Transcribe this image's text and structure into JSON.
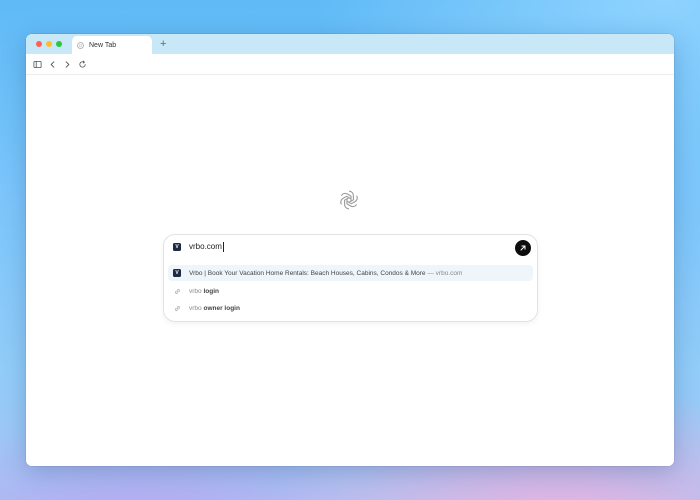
{
  "browser": {
    "tab": {
      "title": "New Tab"
    },
    "new_tab_label": "+"
  },
  "omnibox": {
    "value": "vrbo.com",
    "site_icon_letter": "V",
    "suggestions": [
      {
        "type": "site",
        "icon_letter": "V",
        "title": "Vrbo | Book Your Vacation Home Rentals: Beach Houses, Cabins, Condos & More",
        "separator": " — ",
        "url": "vrbo.com"
      },
      {
        "type": "search",
        "prefix": "vrbo",
        "suffix": "login"
      },
      {
        "type": "search",
        "prefix": "vrbo",
        "suffix": "owner login"
      }
    ]
  },
  "colors": {
    "accent": "#0d0d0d",
    "tabbar": "#c9e8f7",
    "highlight": "#eef5fb"
  },
  "icons": [
    "sidebar-icon",
    "back-icon",
    "forward-icon",
    "reload-icon",
    "openai-logo-icon",
    "arrow-up-right-icon",
    "link-icon"
  ]
}
